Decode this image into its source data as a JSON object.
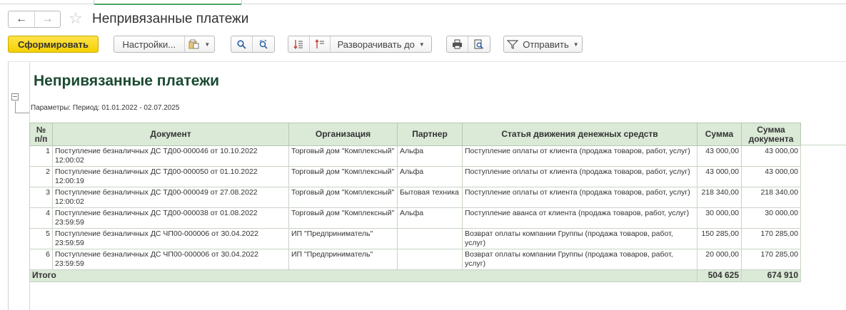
{
  "window": {
    "title": "Непривязанные платежи"
  },
  "nav": {
    "back_glyph": "←",
    "forward_glyph": "→"
  },
  "toolbar": {
    "generate_label": "Сформировать",
    "settings_label": "Настройки...",
    "expand_label": "Разворачивать до",
    "send_label": "Отправить"
  },
  "report": {
    "title": "Непривязанные платежи",
    "params": "Параметры: Период: 01.01.2022 - 02.07.2025",
    "columns": [
      "№\nп/п",
      "Документ",
      "Организация",
      "Партнер",
      "Статья движения денежных средств",
      "Сумма",
      "Сумма документа"
    ],
    "rows": [
      {
        "n": "1",
        "doc": "Поступление безналичных ДС ТД00-000046 от 10.10.2022 12:00:02",
        "org": "Торговый дом \"Комплексный\"",
        "partner": "Альфа",
        "article": "Поступление оплаты от клиента (продажа товаров, работ, услуг)",
        "sum": "43 000,00",
        "docsum": "43 000,00"
      },
      {
        "n": "2",
        "doc": "Поступление безналичных ДС ТД00-000050 от 01.10.2022 12:00:19",
        "org": "Торговый дом \"Комплексный\"",
        "partner": "Альфа",
        "article": "Поступление оплаты от клиента (продажа товаров, работ, услуг)",
        "sum": "43 000,00",
        "docsum": "43 000,00"
      },
      {
        "n": "3",
        "doc": "Поступление безналичных ДС ТД00-000049 от 27.08.2022 12:00:02",
        "org": "Торговый дом \"Комплексный\"",
        "partner": "Бытовая техника",
        "article": "Поступление оплаты от клиента (продажа товаров, работ, услуг)",
        "sum": "218 340,00",
        "docsum": "218 340,00"
      },
      {
        "n": "4",
        "doc": "Поступление безналичных ДС ТД00-000038 от 01.08.2022 23:59:59",
        "org": "Торговый дом \"Комплексный\"",
        "partner": "Альфа",
        "article": "Поступление аванса от клиента (продажа товаров, работ, услуг)",
        "sum": "30 000,00",
        "docsum": "30 000,00"
      },
      {
        "n": "5",
        "doc": "Поступление безналичных ДС ЧП00-000006 от 30.04.2022 23:59:59",
        "org": "ИП \"Предприниматель\"",
        "partner": "",
        "article": "Возврат оплаты компании Группы (продажа товаров, работ, услуг)",
        "sum": "150 285,00",
        "docsum": "170 285,00"
      },
      {
        "n": "6",
        "doc": "Поступление безналичных ДС ЧП00-000006 от 30.04.2022 23:59:59",
        "org": "ИП \"Предприниматель\"",
        "partner": "",
        "article": "Возврат оплаты компании Группы (продажа товаров, работ, услуг)",
        "sum": "20 000,00",
        "docsum": "170 285,00"
      }
    ],
    "total": {
      "label": "Итого",
      "sum": "504 625",
      "docsum": "674 910"
    }
  },
  "colors": {
    "accent_yellow": "#f5d100",
    "header_green": "#dbe9d7",
    "title_green": "#1c4a33"
  }
}
